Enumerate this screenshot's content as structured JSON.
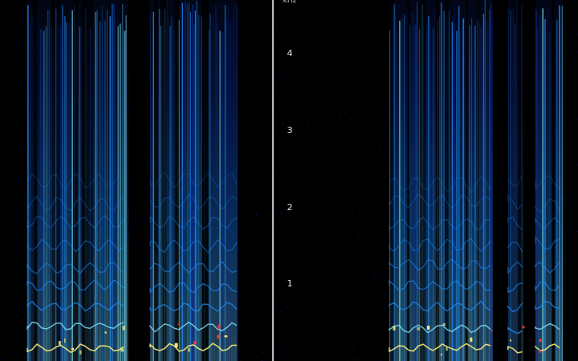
{
  "frequency_axis": {
    "unit": "kHz",
    "ticks": [
      {
        "label": "4",
        "khz": 4
      },
      {
        "label": "3",
        "khz": 3
      },
      {
        "label": "2",
        "khz": 2
      },
      {
        "label": "1",
        "khz": 1
      }
    ],
    "max_khz": 4.7
  },
  "colors": {
    "background": "#000000",
    "low": "#0a2a8c",
    "mid": "#1e90ff",
    "high": "#7fe7ff",
    "peak": "#fff27a",
    "hot": "#ff3b2f",
    "divider": "#b9bcc4"
  },
  "panes": [
    {
      "name": "left-spectrogram",
      "speech_regions": [
        {
          "start": 0.1,
          "end": 0.47,
          "intensity": 0.85
        },
        {
          "start": 0.55,
          "end": 0.87,
          "intensity": 0.9
        }
      ],
      "noise_floor": 0.08
    },
    {
      "name": "right-spectrogram",
      "speech_regions": [
        {
          "start": 0.38,
          "end": 0.72,
          "intensity": 0.95
        },
        {
          "start": 0.77,
          "end": 0.82,
          "intensity": 0.6
        },
        {
          "start": 0.86,
          "end": 0.95,
          "intensity": 0.9
        }
      ],
      "noise_floor": 0.12
    }
  ]
}
